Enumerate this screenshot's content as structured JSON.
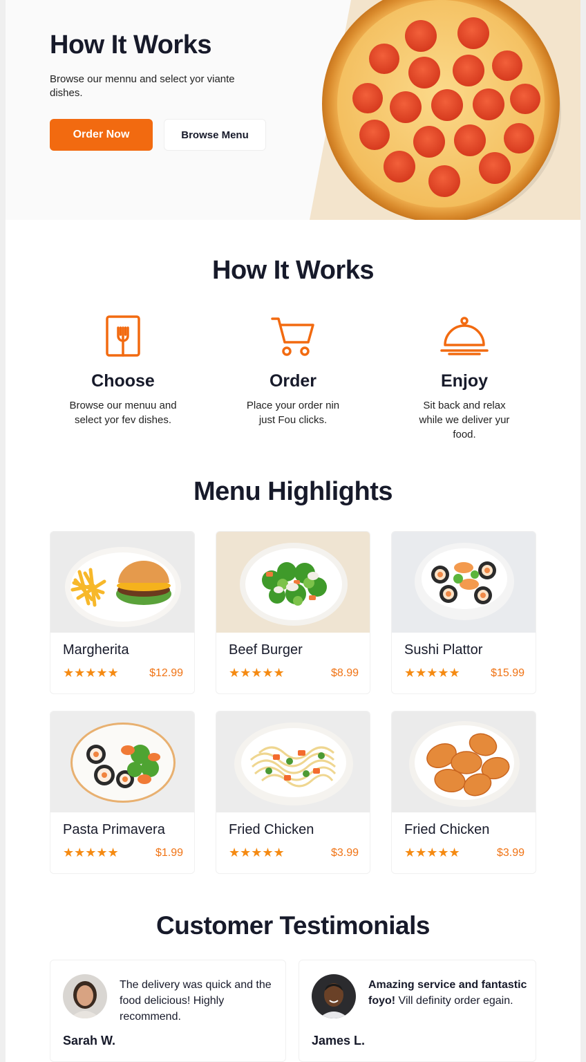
{
  "hero": {
    "title": "How It Works",
    "subtitle": "Browse our mennu and select yor viante dishes.",
    "primary_button": "Order Now",
    "secondary_button": "Browse Menu"
  },
  "how_it_works": {
    "title": "How It Works",
    "steps": [
      {
        "icon": "menu-fork-icon",
        "title": "Choose",
        "desc": "Browse our menuu and select yor fev dishes."
      },
      {
        "icon": "shopping-cart-icon",
        "title": "Order",
        "desc": "Place your order nin just Fou clicks."
      },
      {
        "icon": "serving-cloche-icon",
        "title": "Enjoy",
        "desc": "Sit back and relax while we deliver yur food."
      }
    ]
  },
  "menu": {
    "title": "Menu Highlights",
    "stars": "★★★★★",
    "items": [
      {
        "name": "Margherita",
        "price": "$12.99",
        "image": "burger-and-fries"
      },
      {
        "name": "Beef Burger",
        "price": "$8.99",
        "image": "salad"
      },
      {
        "name": "Sushi Plattor",
        "price": "$15.99",
        "image": "sushi-bowl"
      },
      {
        "name": "Pasta Primavera",
        "price": "$1.99",
        "image": "sushi-salad-plate"
      },
      {
        "name": "Fried Chicken",
        "price": "$3.99",
        "image": "noodles"
      },
      {
        "name": "Fried Chicken",
        "price": "$3.99",
        "image": "fried-chicken"
      }
    ]
  },
  "testimonials": {
    "title": "Customer Testimonials",
    "items": [
      {
        "quote": "The delivery was quick and the food delicious! Highly recommend.",
        "name": "Sarah W."
      },
      {
        "quote": "Amazing service and fantastic foyo! Vill definity order egain.",
        "name": "James L."
      }
    ]
  },
  "colors": {
    "accent": "#f26a10",
    "star": "#f58a12",
    "text": "#171a2a"
  }
}
